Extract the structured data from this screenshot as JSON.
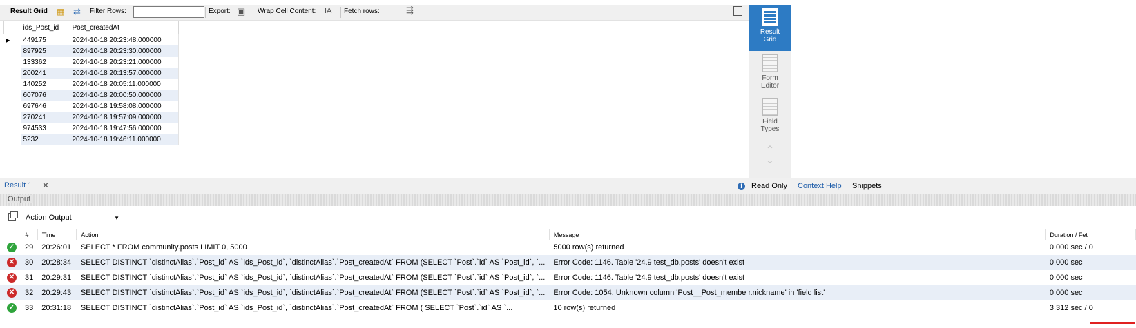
{
  "toolbar": {
    "result_grid_label": "Result Grid",
    "filter_rows_label": "Filter Rows:",
    "filter_rows_value": "",
    "export_label": "Export:",
    "wrap_label": "Wrap Cell Content:",
    "fetch_label": "Fetch rows:"
  },
  "grid": {
    "columns": [
      "ids_Post_id",
      "Post_createdAt"
    ],
    "rows": [
      [
        "449175",
        "2024-10-18 20:23:48.000000"
      ],
      [
        "897925",
        "2024-10-18 20:23:30.000000"
      ],
      [
        "133362",
        "2024-10-18 20:23:21.000000"
      ],
      [
        "200241",
        "2024-10-18 20:13:57.000000"
      ],
      [
        "140252",
        "2024-10-18 20:05:11.000000"
      ],
      [
        "607076",
        "2024-10-18 20:00:50.000000"
      ],
      [
        "697646",
        "2024-10-18 19:58:08.000000"
      ],
      [
        "270241",
        "2024-10-18 19:57:09.000000"
      ],
      [
        "974533",
        "2024-10-18 19:47:56.000000"
      ],
      [
        "5232",
        "2024-10-18 19:46:11.000000"
      ]
    ]
  },
  "side_panel": {
    "result_grid": [
      "Result",
      "Grid"
    ],
    "form_editor": [
      "Form",
      "Editor"
    ],
    "field_types": [
      "Field",
      "Types"
    ]
  },
  "tabs": {
    "result_tab": "Result 1",
    "read_only": "Read Only",
    "context_help": "Context Help",
    "snippets": "Snippets"
  },
  "output": {
    "title": "Output",
    "selector": "Action Output",
    "columns": [
      "#",
      "Time",
      "Action",
      "Message",
      "Duration / Fet"
    ],
    "rows": [
      {
        "status": "ok",
        "num": "29",
        "time": "20:26:01",
        "action": "SELECT * FROM community.posts LIMIT 0, 5000",
        "message": "5000 row(s) returned",
        "duration": "0.000 sec / 0"
      },
      {
        "status": "err",
        "num": "30",
        "time": "20:28:34",
        "action": "SELECT DISTINCT `distinctAlias`.`Post_id` AS `ids_Post_id`, `distinctAlias`.`Post_createdAt` FROM (SELECT `Post`.`id` AS `Post_id`, `...",
        "message": "Error Code: 1146. Table '24.9 test_db.posts' doesn't exist",
        "duration": "0.000 sec"
      },
      {
        "status": "err",
        "num": "31",
        "time": "20:29:31",
        "action": "SELECT DISTINCT `distinctAlias`.`Post_id` AS `ids_Post_id`, `distinctAlias`.`Post_createdAt`  FROM (SELECT `Post`.`id` AS `Post_id`, `...",
        "message": "Error Code: 1146. Table '24.9 test_db.posts' doesn't exist",
        "duration": "0.000 sec"
      },
      {
        "status": "err",
        "num": "32",
        "time": "20:29:43",
        "action": "SELECT DISTINCT `distinctAlias`.`Post_id` AS `ids_Post_id`, `distinctAlias`.`Post_createdAt`  FROM (SELECT `Post`.`id` AS `Post_id`, `...",
        "message": "Error Code: 1054. Unknown column 'Post__Post_membe r.nickname' in 'field list'",
        "duration": "0.000 sec"
      },
      {
        "status": "ok",
        "num": "33",
        "time": "20:31:18",
        "action": "SELECT DISTINCT `distinctAlias`.`Post_id` AS `ids_Post_id`, `distinctAlias`.`Post_createdAt`  FROM (     SELECT         `Post`.`id` AS `...",
        "message": "10 row(s) returned",
        "duration": "3.312 sec / 0"
      }
    ]
  },
  "colors": {
    "accent": "#2d7bc4",
    "ok": "#2fa43c",
    "error": "#cc2a2a",
    "alt_row": "#e8eef7",
    "underline": "#e02020"
  }
}
